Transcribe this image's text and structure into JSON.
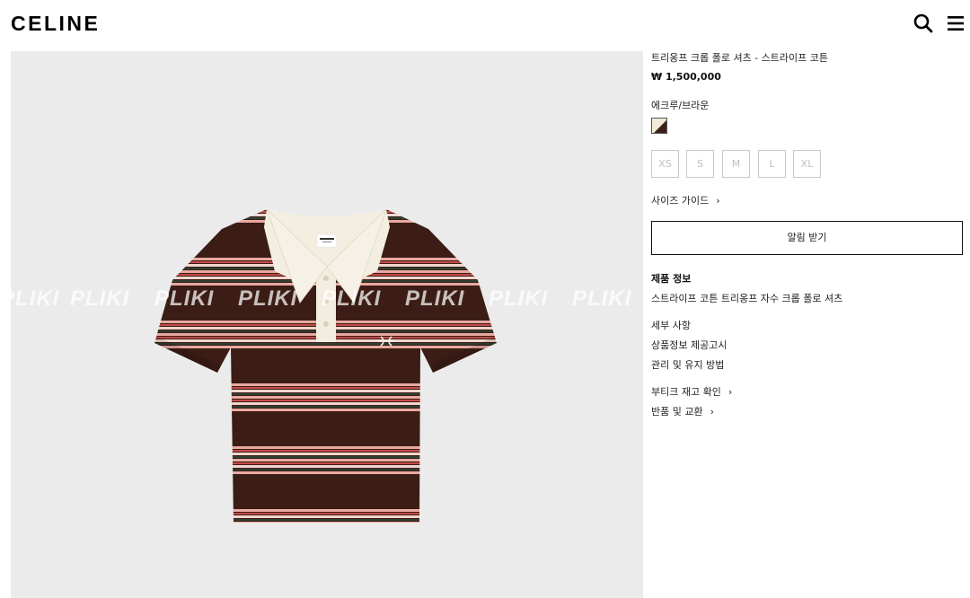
{
  "header": {
    "logo": "CELINE",
    "search_icon": "search-icon",
    "menu_icon": "hamburger-menu-icon"
  },
  "image": {
    "watermark": [
      "PLIKI",
      "PLIKI",
      "PLIKI",
      "PLIKI",
      "PLIKI",
      "PLIKI",
      "PLIKI",
      "PLIKI"
    ]
  },
  "product": {
    "title": "트리옹프 크롭 폴로 셔츠 - 스트라이프 코튼",
    "price": "₩ 1,500,000",
    "color_name": "에크루/브라운",
    "swatch_colors": [
      "#f1ead9",
      "#3a2018"
    ],
    "sizes": [
      "XS",
      "S",
      "M",
      "L",
      "XL"
    ],
    "size_guide": "사이즈 가이드",
    "notify_button": "알림 받기",
    "section_title": "제품 정보",
    "description": "스트라이프 코튼 트리옹프 자수 크롭 폴로 셔츠",
    "links": [
      "세부 사항",
      "상품정보 제공고시",
      "관리 및 유지 방법"
    ],
    "links_arrow": [
      "부티크 재고 확인",
      "반품 및 교환"
    ],
    "chevron": "›"
  }
}
